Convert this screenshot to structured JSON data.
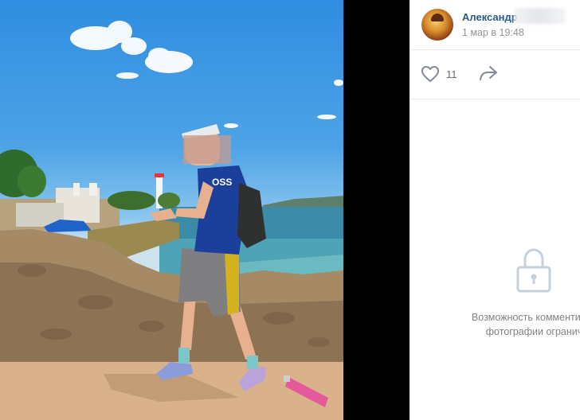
{
  "post": {
    "author_name": "Александр",
    "date": "1 мар в 19:48"
  },
  "actions": {
    "like_count": "11",
    "like_icon": "heart-outline-icon",
    "share_icon": "share-arrow-icon"
  },
  "comments": {
    "restricted_icon": "lock-icon",
    "restricted_line1": "Возможность комментирова",
    "restricted_line2": "фотографии ограниче"
  },
  "photo": {
    "shirt_text": "OSS"
  },
  "colors": {
    "link": "#2a5885",
    "muted": "#939393",
    "icon": "#828a99",
    "lock": "#c5d0db"
  }
}
